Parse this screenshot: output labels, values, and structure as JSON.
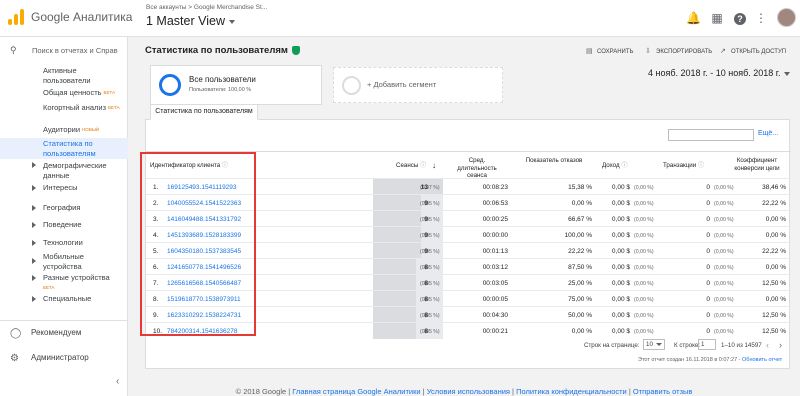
{
  "app": {
    "title": "Google Аналитика",
    "breadcrumb": "Все аккаунты > Google Merchandise St...",
    "view": "1 Master View"
  },
  "icons": {
    "logo": "analytics-logo",
    "bell": "bell-icon",
    "apps": "apps-grid-icon",
    "help": "help-icon",
    "more": "more-vert-icon"
  },
  "sidebar": {
    "search_placeholder": "Поиск в отчетах и Справ",
    "items": [
      {
        "label": "Активные пользователи"
      },
      {
        "label": "Общая ценность",
        "badge": "БЕТА"
      },
      {
        "label": "Когортный анализ",
        "badge": "БЕТА"
      },
      {
        "label": "Аудитории",
        "badge": "НОВЫЙ"
      },
      {
        "label": "Статистика по пользователям",
        "selected": true
      },
      {
        "label": "Демографические данные"
      },
      {
        "label": "Интересы"
      },
      {
        "label": "География"
      },
      {
        "label": "Поведение"
      },
      {
        "label": "Технологии"
      },
      {
        "label": "Мобильные устройства"
      },
      {
        "label": "Разные устройства",
        "badge": "БЕТА"
      },
      {
        "label": "Специальные"
      }
    ],
    "recommend": "Рекомендуем",
    "admin": "Администратор"
  },
  "report": {
    "title": "Статистика по пользователям",
    "save": "СОХРАНИТЬ",
    "export": "ЭКСПОРТИРОВАТЬ",
    "share": "ОТКРЫТЬ ДОСТУП",
    "segment_name": "Все пользователи",
    "segment_sub": "Пользователи: 100,00 %",
    "add_segment": "+ Добавить сегмент",
    "date_range": "4 нояб. 2018 г. - 10 нояб. 2018 г.",
    "tab": "Статистика по пользователям",
    "etc": "Ещё..."
  },
  "table": {
    "headers": {
      "client": "Идентификатор клиента",
      "sessions": "Сеансы",
      "duration": "Сред. длительность сеанса",
      "bounce": "Показатель отказов",
      "revenue": "Доход",
      "transactions": "Транзакции",
      "conversion": "Коэффициент конверсии цели"
    },
    "rows": [
      {
        "n": "1.",
        "id": "169125493.1541119293",
        "sessions": "13",
        "pct": "(0,07 %)",
        "dur": "00:08:23",
        "bounce": "15,38 %",
        "rev": "0,00 $",
        "rev_pct": "(0,00 %)",
        "tr": "0",
        "tr_pct": "(0,00 %)",
        "conv": "38,46 %"
      },
      {
        "n": "2.",
        "id": "1040055524.1541522363",
        "sessions": "9",
        "pct": "(0,05 %)",
        "dur": "00:06:53",
        "bounce": "0,00 %",
        "rev": "0,00 $",
        "rev_pct": "(0,00 %)",
        "tr": "0",
        "tr_pct": "(0,00 %)",
        "conv": "22,22 %"
      },
      {
        "n": "3.",
        "id": "1416049488.1541331792",
        "sessions": "9",
        "pct": "(0,05 %)",
        "dur": "00:00:25",
        "bounce": "66,67 %",
        "rev": "0,00 $",
        "rev_pct": "(0,00 %)",
        "tr": "0",
        "tr_pct": "(0,00 %)",
        "conv": "0,00 %"
      },
      {
        "n": "4.",
        "id": "1451393689.1528183399",
        "sessions": "9",
        "pct": "(0,05 %)",
        "dur": "00:00:00",
        "bounce": "100,00 %",
        "rev": "0,00 $",
        "rev_pct": "(0,00 %)",
        "tr": "0",
        "tr_pct": "(0,00 %)",
        "conv": "0,00 %"
      },
      {
        "n": "5.",
        "id": "1604350180.1537383545",
        "sessions": "9",
        "pct": "(0,05 %)",
        "dur": "00:01:13",
        "bounce": "22,22 %",
        "rev": "0,00 $",
        "rev_pct": "(0,00 %)",
        "tr": "0",
        "tr_pct": "(0,00 %)",
        "conv": "22,22 %"
      },
      {
        "n": "6.",
        "id": "1241650778.1541496526",
        "sessions": "8",
        "pct": "(0,05 %)",
        "dur": "00:03:12",
        "bounce": "87,50 %",
        "rev": "0,00 $",
        "rev_pct": "(0,00 %)",
        "tr": "0",
        "tr_pct": "(0,00 %)",
        "conv": "0,00 %"
      },
      {
        "n": "7.",
        "id": "1265616568.1540566487",
        "sessions": "8",
        "pct": "(0,05 %)",
        "dur": "00:03:05",
        "bounce": "25,00 %",
        "rev": "0,00 $",
        "rev_pct": "(0,00 %)",
        "tr": "0",
        "tr_pct": "(0,00 %)",
        "conv": "12,50 %"
      },
      {
        "n": "8.",
        "id": "1519618770.1538973911",
        "sessions": "8",
        "pct": "(0,05 %)",
        "dur": "00:00:05",
        "bounce": "75,00 %",
        "rev": "0,00 $",
        "rev_pct": "(0,00 %)",
        "tr": "0",
        "tr_pct": "(0,00 %)",
        "conv": "0,00 %"
      },
      {
        "n": "9.",
        "id": "1623310292.1538224731",
        "sessions": "8",
        "pct": "(0,05 %)",
        "dur": "00:04:30",
        "bounce": "50,00 %",
        "rev": "0,00 $",
        "rev_pct": "(0,00 %)",
        "tr": "0",
        "tr_pct": "(0,00 %)",
        "conv": "12,50 %"
      },
      {
        "n": "10.",
        "id": "784200314.1541636278",
        "sessions": "8",
        "pct": "(0,05 %)",
        "dur": "00:00:21",
        "bounce": "0,00 %",
        "rev": "0,00 $",
        "rev_pct": "(0,00 %)",
        "tr": "0",
        "tr_pct": "(0,00 %)",
        "conv": "12,50 %"
      }
    ],
    "session_max": 13,
    "rows_per_page_label": "Строк на странице:",
    "rows_per_page": "10",
    "goto_label": "К строке:",
    "goto": "1",
    "range": "1–10 из 14597",
    "generated": "Этот отчет создан 16.11.2018 в 0:07:27 -",
    "refresh": "Обновить отчет"
  },
  "footer": {
    "copyright": "© 2018 Google",
    "links": [
      "Главная страница Google Аналитики",
      "Условия использования",
      "Политика конфиденциальности",
      "Отправить отзыв"
    ]
  },
  "colors": {
    "accent": "#1a73e8",
    "highlight": "#e53935",
    "logo": "#f9ab00"
  }
}
